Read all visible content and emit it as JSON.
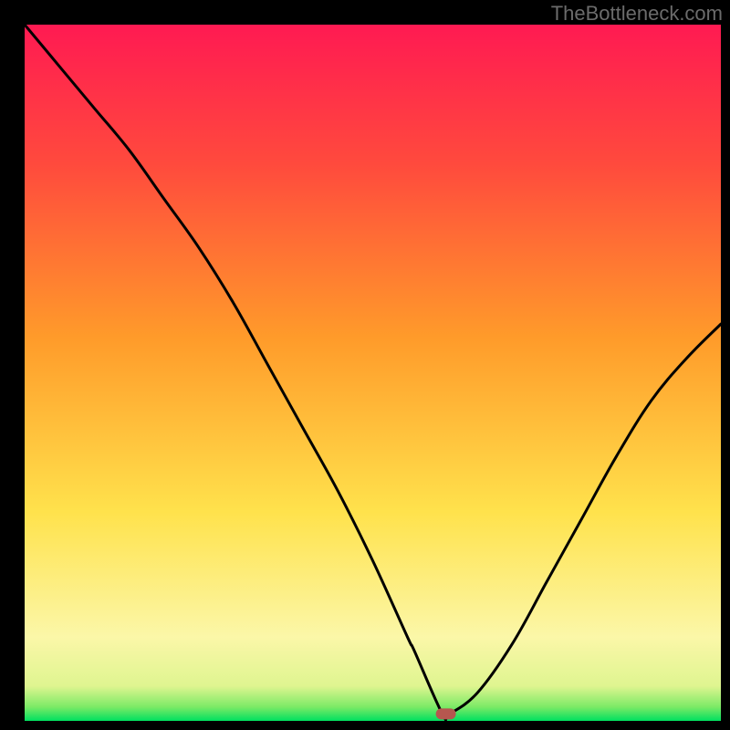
{
  "watermark": "TheBottleneck.com",
  "chart_data": {
    "type": "line",
    "title": "",
    "xlabel": "",
    "ylabel": "",
    "xlim": [
      0,
      100
    ],
    "ylim": [
      0,
      100
    ],
    "x": [
      0,
      5,
      10,
      15,
      20,
      25,
      30,
      35,
      40,
      45,
      50,
      55,
      56,
      60,
      61,
      65,
      70,
      75,
      80,
      85,
      90,
      95,
      100
    ],
    "values": [
      100,
      94,
      88,
      82,
      75,
      68,
      60,
      51,
      42,
      33,
      23,
      12,
      10,
      1,
      1,
      4,
      11,
      20,
      29,
      38,
      46,
      52,
      57
    ],
    "marker": {
      "x": 60.5,
      "y": 1
    },
    "gradient_stops": [
      {
        "offset": 0.0,
        "color": "#00e060"
      },
      {
        "offset": 0.02,
        "color": "#7cea66"
      },
      {
        "offset": 0.05,
        "color": "#dff590"
      },
      {
        "offset": 0.12,
        "color": "#fbf7a8"
      },
      {
        "offset": 0.3,
        "color": "#ffe24c"
      },
      {
        "offset": 0.55,
        "color": "#ff9b2a"
      },
      {
        "offset": 0.8,
        "color": "#ff4a3d"
      },
      {
        "offset": 1.0,
        "color": "#ff1a52"
      }
    ]
  }
}
